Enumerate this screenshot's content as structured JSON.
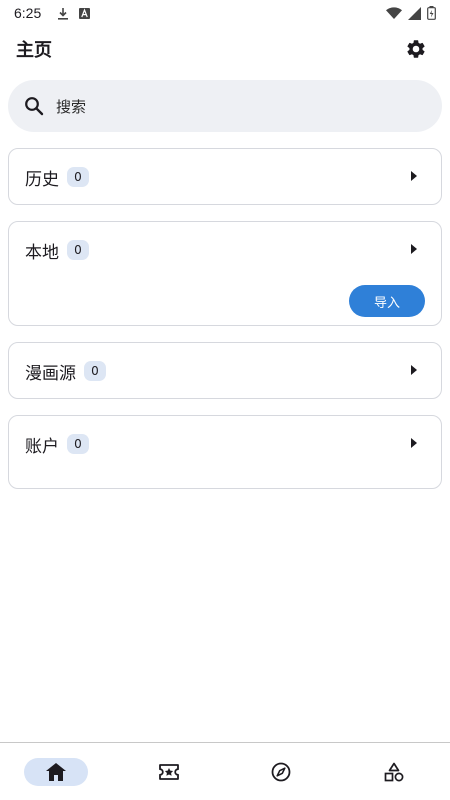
{
  "status_bar": {
    "time": "6:25",
    "icons": [
      "download-icon",
      "app-a-icon",
      "wifi-icon",
      "signal-icon",
      "battery-icon"
    ]
  },
  "app_bar": {
    "title": "主页",
    "settings_icon": "gear-icon"
  },
  "search": {
    "label": "搜索",
    "icon": "search-icon"
  },
  "cards": [
    {
      "title": "历史",
      "count": "0"
    },
    {
      "title": "本地",
      "count": "0",
      "action_label": "导入"
    },
    {
      "title": "漫画源",
      "count": "0"
    },
    {
      "title": "账户",
      "count": "0"
    }
  ],
  "bottom_nav": {
    "items": [
      {
        "icon": "home-icon",
        "active": true
      },
      {
        "icon": "ticket-star-icon",
        "active": false
      },
      {
        "icon": "compass-icon",
        "active": false
      },
      {
        "icon": "shapes-icon",
        "active": false
      }
    ]
  },
  "colors": {
    "accent": "#2f80d8",
    "search_bg": "#eef0f4",
    "badge_bg": "#dde6f4",
    "nav_active_bg": "#d7e3f6"
  }
}
